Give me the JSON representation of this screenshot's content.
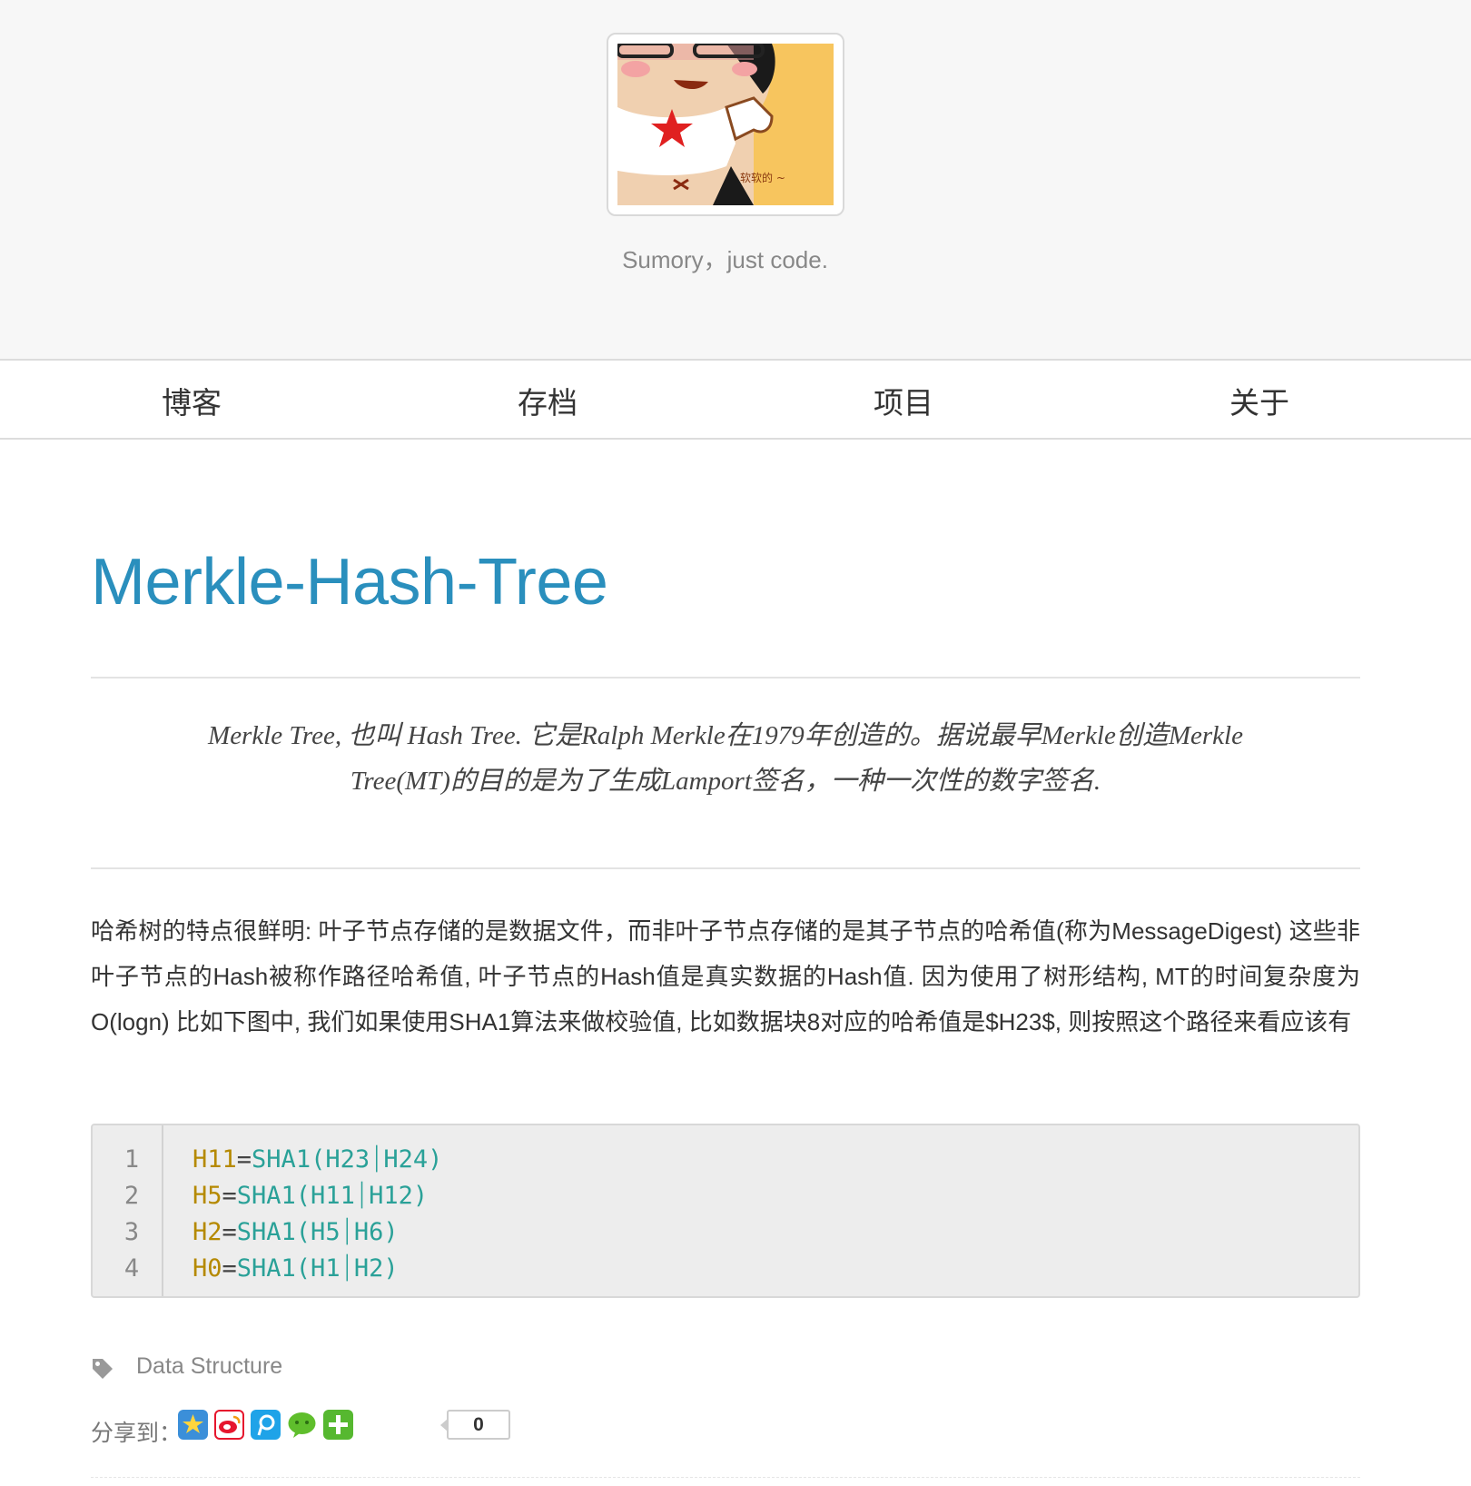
{
  "header": {
    "tagline": "Sumory，just code.",
    "avatar_caption": "软软的 ~"
  },
  "nav": {
    "items": [
      {
        "label": "博客"
      },
      {
        "label": "存档"
      },
      {
        "label": "项目"
      },
      {
        "label": "关于"
      }
    ]
  },
  "post": {
    "title": "Merkle-Hash-Tree",
    "quote_line1": "Merkle Tree, 也叫 Hash Tree. 它是Ralph Merkle在1979年创造的。据说最早Merkle创造Merkle",
    "quote_line2": "Tree(MT)的目的是为了生成Lamport签名，一种一次性的数字签名.",
    "body": "哈希树的特点很鲜明: 叶子节点存储的是数据文件，而非叶子节点存储的是其子节点的哈希值(称为MessageDigest) 这些非叶子节点的Hash被称作路径哈希值, 叶子节点的Hash值是真实数据的Hash值. 因为使用了树形结构, MT的时间复杂度为 O(logn) 比如下图中, 我们如果使用SHA1算法来做校验值, 比如数据块8对应的哈希值是$H23$, 则按照这个路径来看应该有",
    "code": [
      {
        "no": "1",
        "lhs": "H11",
        "eq": "=",
        "rhs": "SHA1(H23⏐H24)"
      },
      {
        "no": "2",
        "lhs": "H5",
        "eq": "=",
        "rhs": "SHA1(H11⏐H12)"
      },
      {
        "no": "3",
        "lhs": "H2",
        "eq": "=",
        "rhs": "SHA1(H5⏐H6)"
      },
      {
        "no": "4",
        "lhs": "H0",
        "eq": "=",
        "rhs": "SHA1(H1⏐H2)"
      }
    ],
    "tag": "Data Structure",
    "share_label": "分享到：",
    "share_count": "0"
  },
  "colors": {
    "title": "#2a8fbd",
    "code_keyword": "#b58900",
    "code_function": "#2aa198"
  }
}
